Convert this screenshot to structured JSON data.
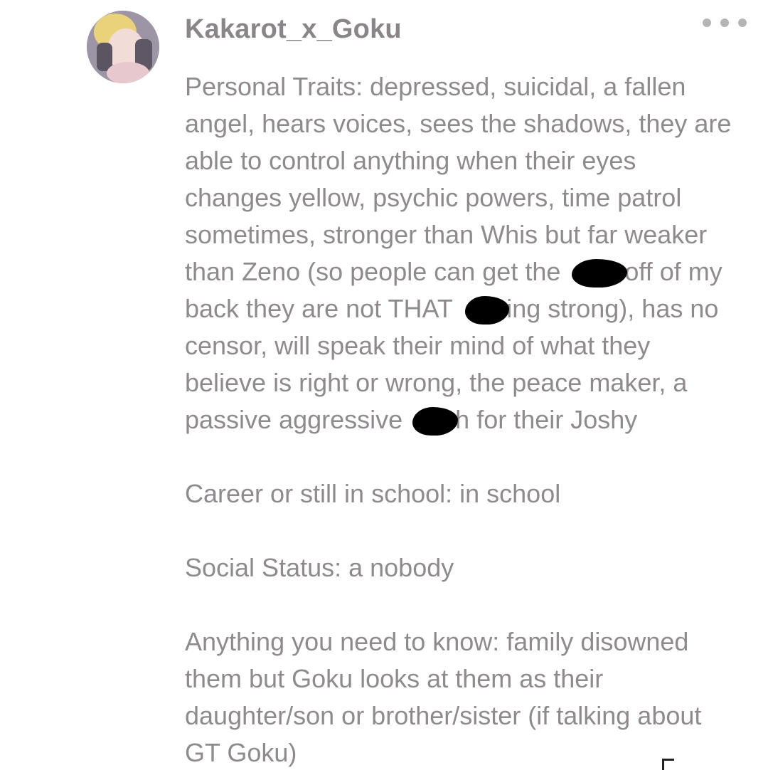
{
  "post": {
    "username": "Kakarot_x_Goku",
    "avatar_icon": "anime-character-avatar",
    "more_icon": "more-horizontal-icon",
    "traits": {
      "l1": "Personal Traits: depressed, suicidal, a fallen",
      "l2": "angel, hears voices, sees the shadows, they are",
      "l3": "able to control anything when their eyes",
      "l4": "changes yellow, psychic powers, time patrol",
      "l5": "sometimes, stronger than Whis but far weaker",
      "l6a": "than Zeno (so people can get the ",
      "l6b": "off of my",
      "l7a": "back they are not THAT ",
      "l7b": "ing strong), has no",
      "l8": "censor, will speak their mind of what they",
      "l9": "believe is right or wrong, the peace maker, a",
      "l10a": "passive aggressive ",
      "l10b": "h for their Joshy"
    },
    "career": "Career or still in school: in school",
    "social": "Social Status: a nobody",
    "anything": {
      "l1": "Anything you need to know: family disowned",
      "l2": "them but Goku looks at them as their",
      "l3": "daughter/son or brother/sister (if talking about",
      "l4": "GT Goku)"
    }
  }
}
